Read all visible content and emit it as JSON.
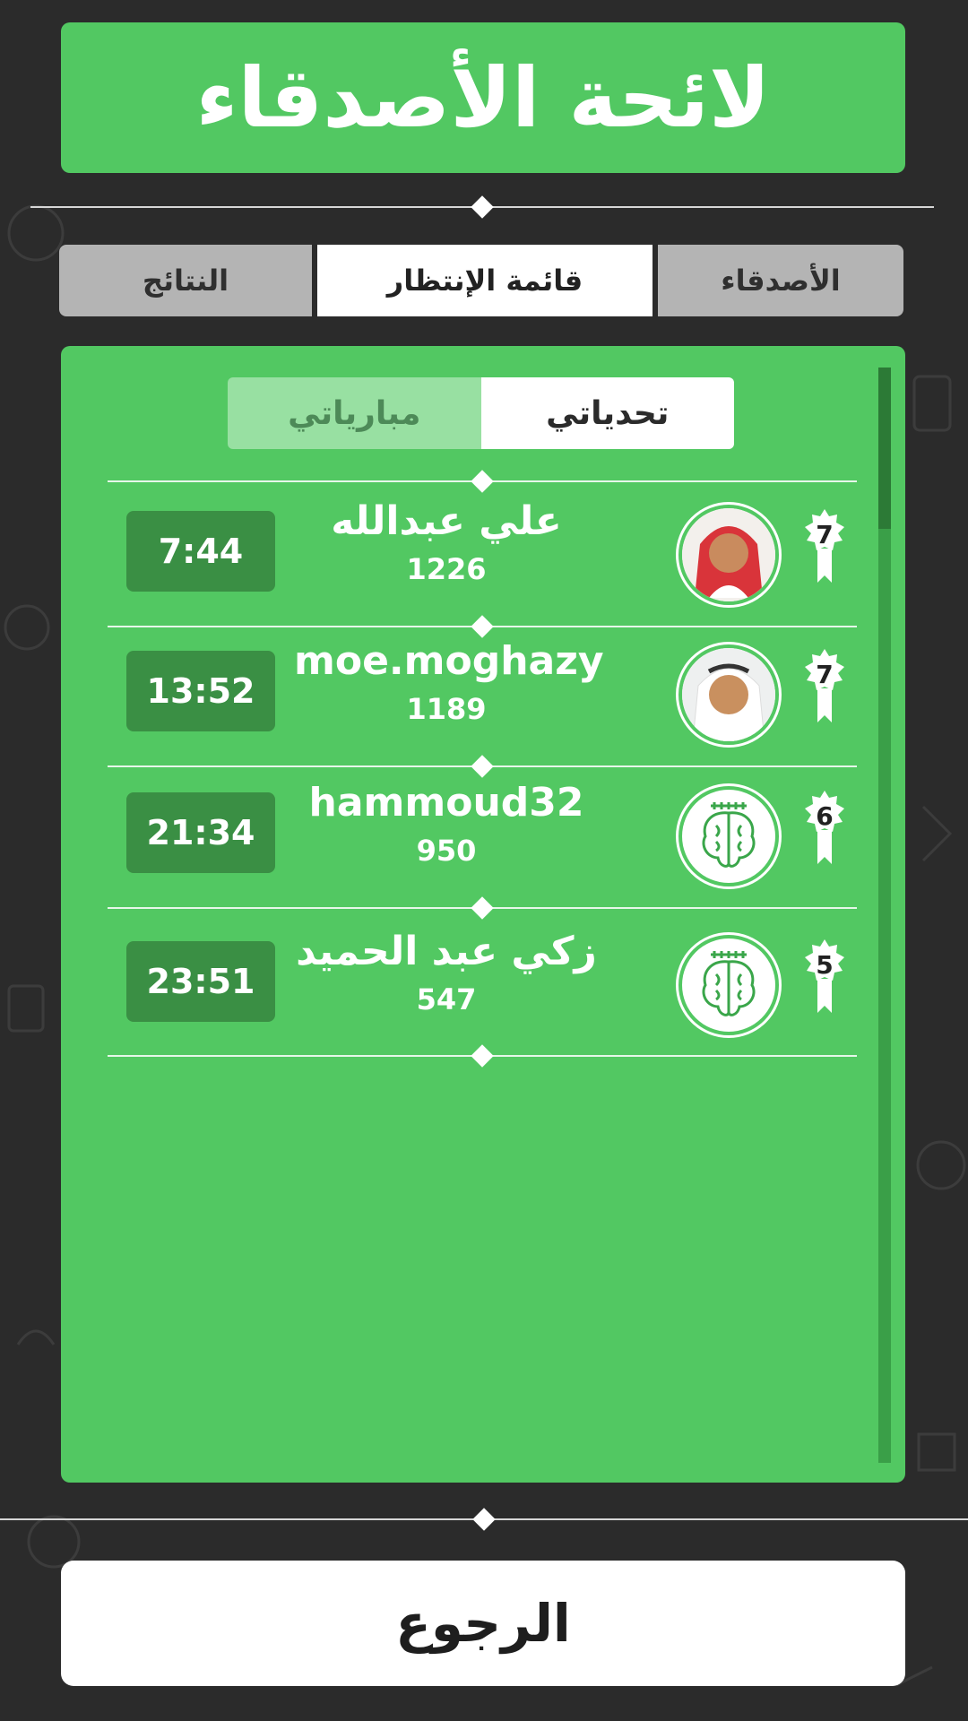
{
  "header": {
    "title": "لائحة الأصدقاء"
  },
  "tabs": {
    "friends": "الأصدقاء",
    "waiting": "قائمة الإنتظار",
    "results": "النتائج"
  },
  "subtabs": {
    "my_challenges": "تحدياتي",
    "my_matches": "مبارياتي"
  },
  "players": [
    {
      "rank": "7",
      "name": "علي عبدالله",
      "score": "1226",
      "time": "7:44",
      "avatar": "photo-avatar"
    },
    {
      "rank": "7",
      "name": "moe.moghazy",
      "score": "1189",
      "time": "13:52",
      "avatar": "photo-avatar"
    },
    {
      "rank": "6",
      "name": "hammoud32",
      "score": "950",
      "time": "21:34",
      "avatar": "brain-icon"
    },
    {
      "rank": "5",
      "name": "زكي عبد الحميد",
      "score": "547",
      "time": "23:51",
      "avatar": "brain-icon"
    }
  ],
  "footer": {
    "back": "الرجوع"
  },
  "colors": {
    "green": "#52c862",
    "dark_green": "#3a8f44",
    "background": "#2b2b2b"
  }
}
